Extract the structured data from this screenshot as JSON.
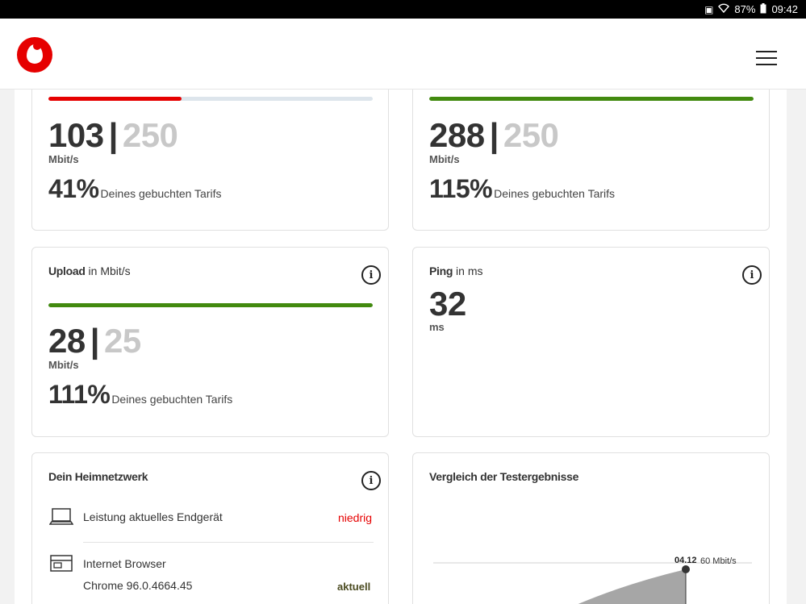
{
  "status_bar": {
    "battery": "87%",
    "time": "09:42"
  },
  "download_card": {
    "measured": "103",
    "booked": "250",
    "unit": "Mbit/s",
    "percent": "41%",
    "percent_text": "Deines gebuchten Tarifs",
    "progress_fraction": 0.41,
    "bar_color": "#e60000"
  },
  "second_card": {
    "measured": "288",
    "booked": "250",
    "unit": "Mbit/s",
    "percent": "115%",
    "percent_text": "Deines gebuchten Tarifs",
    "progress_fraction": 1.0,
    "bar_color": "#428a0f"
  },
  "upload_card": {
    "title": "Upload",
    "title_unit": "in Mbit/s",
    "measured": "28",
    "booked": "25",
    "unit": "Mbit/s",
    "percent": "111%",
    "percent_text": "Deines gebuchten Tarifs",
    "progress_fraction": 1.0,
    "bar_color": "#428a0f"
  },
  "ping_card": {
    "title": "Ping",
    "title_unit": "in ms",
    "value": "32",
    "unit": "ms"
  },
  "home_network_card": {
    "title": "Dein Heimnetzwerk",
    "rows": [
      {
        "label": "Leistung aktuelles Endgerät",
        "status": "niedrig"
      },
      {
        "label": "Internet Browser",
        "sublabel": "Chrome 96.0.4664.45",
        "status": "aktuell"
      }
    ]
  },
  "comparison_card": {
    "title": "Vergleich der Testergebnisse",
    "point_label": "04.12",
    "point_value": "60 Mbit/s"
  },
  "colors": {
    "brand_red": "#e60000",
    "good_green": "#428a0f"
  }
}
